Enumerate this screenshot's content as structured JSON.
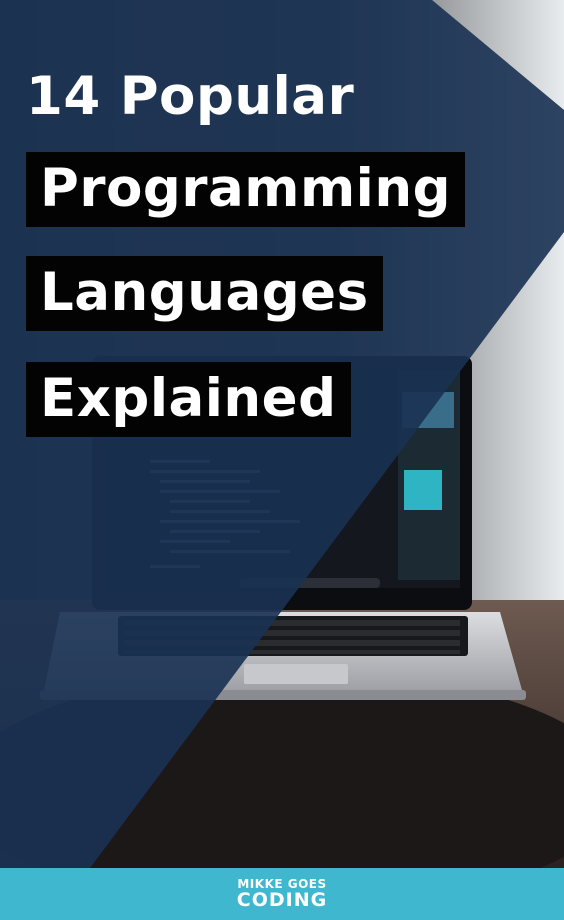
{
  "title": {
    "line1": "14 Popular",
    "line2": "Programming",
    "line3": "Languages",
    "line4": "Explained"
  },
  "footer": {
    "brand_top": "MIKKE GOES",
    "brand_bottom": "CODING"
  },
  "colors": {
    "overlay_blue": "#1f3a5f",
    "title_box": "#030304",
    "footer_bar": "#3fb7cf",
    "text": "#ffffff"
  },
  "icons": [
    "laptop-photo"
  ]
}
